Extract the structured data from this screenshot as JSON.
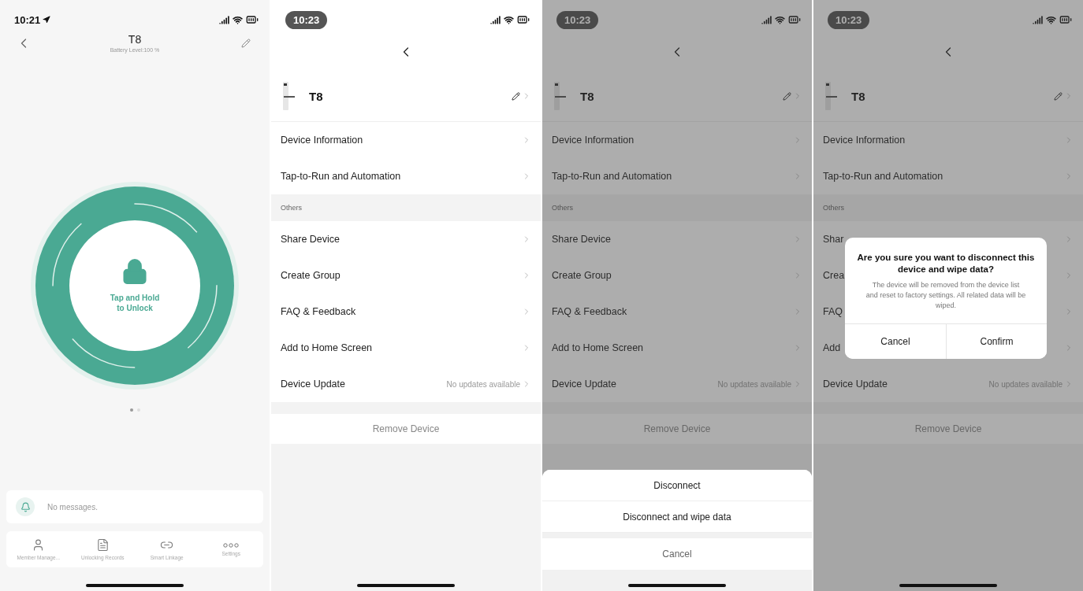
{
  "screens": [
    {
      "kind": "lock",
      "time": "10:21",
      "location": true,
      "recording": false,
      "title": "T8",
      "subtitle": "Battery Level:100 %",
      "unlock_label": "Tap and Hold to Unlock",
      "page_dots": [
        {
          "selected": true
        },
        {
          "selected": false
        }
      ],
      "message": "No messages.",
      "nav": [
        {
          "kind": "person",
          "label": "Member Manage..."
        },
        {
          "kind": "records",
          "label": "Unlocking Records"
        },
        {
          "kind": "link",
          "label": "Smart Linkage"
        },
        {
          "kind": "more",
          "label": "Settings"
        }
      ]
    },
    {
      "kind": "settings",
      "time": "10:23",
      "recording": true,
      "dimmed": false,
      "device_name": "T8",
      "rows": [
        {
          "label": "Device Information"
        },
        {
          "label": "Tap-to-Run and Automation"
        }
      ],
      "section": "Others",
      "others": [
        {
          "label": "Share Device"
        },
        {
          "label": "Create Group"
        },
        {
          "label": "FAQ & Feedback"
        },
        {
          "label": "Add to Home Screen"
        },
        {
          "label": "Device Update",
          "value": "No updates available"
        }
      ],
      "remove": "Remove Device"
    },
    {
      "kind": "settings",
      "time": "10:23",
      "recording": true,
      "dimmed": true,
      "device_name": "T8",
      "rows": [
        {
          "label": "Device Information"
        },
        {
          "label": "Tap-to-Run and Automation"
        }
      ],
      "section": "Others",
      "others": [
        {
          "label": "Share Device"
        },
        {
          "label": "Create Group"
        },
        {
          "label": "FAQ & Feedback"
        },
        {
          "label": "Add to Home Screen"
        },
        {
          "label": "Device Update",
          "value": "No updates available"
        }
      ],
      "remove": "Remove Device",
      "overlay": {
        "kind": "sheet",
        "options": [
          "Disconnect",
          "Disconnect and wipe data"
        ],
        "cancel": "Cancel"
      }
    },
    {
      "kind": "settings",
      "time": "10:23",
      "recording": true,
      "dimmed": true,
      "device_name": "T8",
      "rows": [
        {
          "label": "Device Information"
        },
        {
          "label": "Tap-to-Run and Automation"
        }
      ],
      "section": "Others",
      "others": [
        {
          "label": "Shar"
        },
        {
          "label": "Crea"
        },
        {
          "label": "FAQ"
        },
        {
          "label": "Add"
        },
        {
          "label": "Device Update",
          "value": "No updates available"
        }
      ],
      "remove": "Remove Device",
      "overlay": {
        "kind": "dialog",
        "title": "Are you sure you want to disconnect this device and wipe data?",
        "message": "The device will be removed from the device list and reset to factory settings. All related data will be wiped.",
        "buttons": [
          "Cancel",
          "Confirm"
        ]
      }
    }
  ]
}
